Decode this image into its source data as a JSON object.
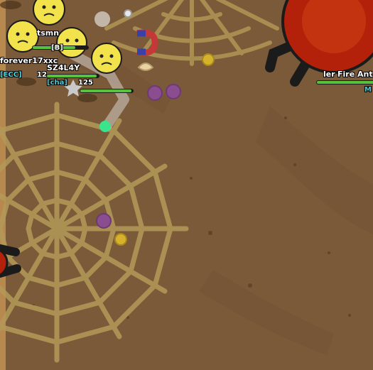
{
  "colors": {
    "ground": "#7b5a39",
    "web": "#b59a55",
    "player_face": "#f2e24b",
    "enemy_fire_ant": "#b3210a",
    "enemy_outline": "#1b1b1b",
    "hp_bar": "#58c23d",
    "petal_glow": "#39e58a",
    "tag_cyan": "#46d6e6"
  },
  "players": [
    {
      "name": "tsmn",
      "tag": ""
    },
    {
      "name": "forever17xxc",
      "tag": "ECC"
    },
    {
      "name": "SZ4L4Y",
      "tag": "[cha]"
    }
  ],
  "labels": {
    "player1_name": "tsmn",
    "player1_tag": "[B]",
    "player2_name": "forever17xxc",
    "player2_tag": "[ECC]",
    "player2_level": "12",
    "player3_name": "SZ4L4Y",
    "player3_tag": "[cha]",
    "player3_level": "125",
    "enemy_name": "Fire Ant",
    "enemy_name_prefix": "ler",
    "enemy_level": "M"
  },
  "icons": [
    "spider-web-icon",
    "sad-face-icon",
    "fire-ant-icon",
    "magnet-icon",
    "shell-icon",
    "star-icon",
    "pollen-icon",
    "berry-icon"
  ]
}
